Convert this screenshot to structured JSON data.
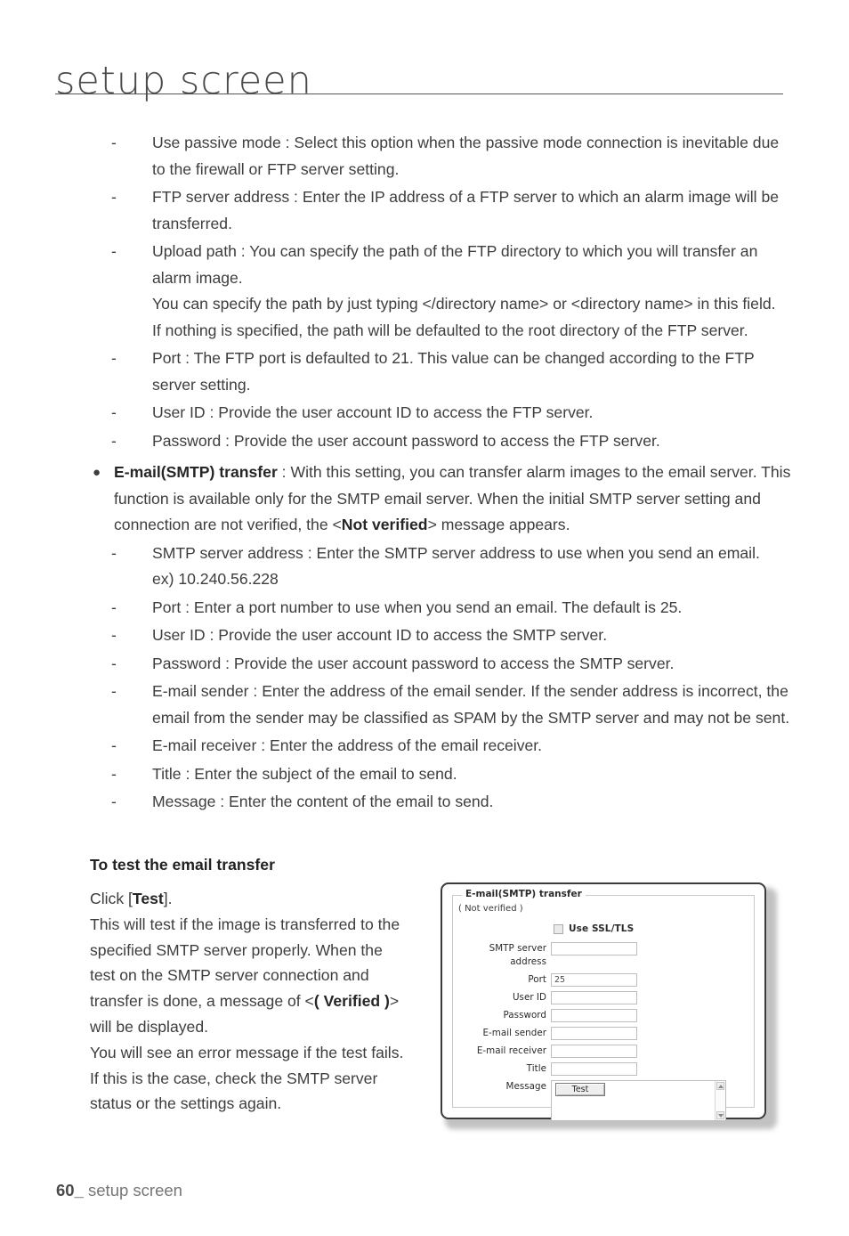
{
  "header": {
    "title": "setup screen"
  },
  "bullets": [
    {
      "mark": "-",
      "type": "dash",
      "lines": [
        "Use passive mode : Select this option when the passive mode connection is inevitable due to the firewall or FTP server setting."
      ]
    },
    {
      "mark": "-",
      "type": "dash",
      "lines": [
        "FTP server address : Enter the IP address of a FTP server to which an alarm image will be transferred."
      ]
    },
    {
      "mark": "-",
      "type": "dash",
      "lines": [
        "Upload path : You can specify the path of the FTP directory to which you will transfer an alarm image.",
        "You can specify the path by just typing </directory name> or <directory name> in this field.",
        "If nothing is specified, the path will be defaulted to the root directory of the FTP server."
      ]
    },
    {
      "mark": "-",
      "type": "dash",
      "lines": [
        "Port : The FTP port is defaulted to 21. This value can be changed according to the FTP server setting."
      ]
    },
    {
      "mark": "-",
      "type": "dash",
      "lines": [
        "User ID : Provide the user account ID to access the FTP server."
      ]
    },
    {
      "mark": "-",
      "type": "dash",
      "lines": [
        "Password : Provide the user account password to access the FTP server."
      ]
    }
  ],
  "smtp_bullet": {
    "mark": "●",
    "bold_lead": "E-mail(SMTP) transfer",
    "text_part1": " : With this setting, you can transfer alarm images to the email server. This function is available only for the SMTP email server. When the initial SMTP server setting and connection are not verified, the <",
    "bold_mid": "Not verified",
    "text_part2": "> message appears."
  },
  "smtp_bullets": [
    {
      "mark": "-",
      "lines": [
        "SMTP server address : Enter the SMTP server address to use when you send an email.",
        "ex) 10.240.56.228"
      ]
    },
    {
      "mark": "-",
      "lines": [
        "Port : Enter a port number to use when you send an email. The default is 25."
      ]
    },
    {
      "mark": "-",
      "lines": [
        "User ID : Provide the user account ID to access the SMTP server."
      ]
    },
    {
      "mark": "-",
      "lines": [
        "Password : Provide the user account password to access the SMTP server."
      ]
    },
    {
      "mark": "-",
      "lines": [
        "E-mail sender : Enter the address of the email sender. If the sender address is incorrect, the email from the sender may be classified as SPAM by the SMTP server and may not be sent."
      ]
    },
    {
      "mark": "-",
      "lines": [
        "E-mail receiver : Enter the address of the email receiver."
      ]
    },
    {
      "mark": "-",
      "lines": [
        "Title : Enter the subject of the email to send."
      ]
    },
    {
      "mark": "-",
      "lines": [
        "Message : Enter the content of the email to send."
      ]
    }
  ],
  "section": {
    "heading": "To test the email transfer",
    "line1_pre": "Click [",
    "line1_bold": "Test",
    "line1_post": "].",
    "line2": "This will test if the image is transferred to the specified SMTP server properly. When the test on the SMTP server connection and transfer is done, a message of <",
    "line2_bold": "( Verified )",
    "line2_post": "> will be displayed.",
    "line3": "You will see an error message if the test fails.",
    "line4": "If this is the case, check the SMTP server status or the settings again."
  },
  "dialog": {
    "legend": "E-mail(SMTP) transfer",
    "status": "( Not verified )",
    "ssl_label": "Use SSL/TLS",
    "ssl_checked": false,
    "fields": [
      {
        "label": "SMTP server address",
        "value": ""
      },
      {
        "label": "Port",
        "value": "25"
      },
      {
        "label": "User ID",
        "value": ""
      },
      {
        "label": "Password",
        "value": ""
      },
      {
        "label": "E-mail sender",
        "value": ""
      },
      {
        "label": "E-mail receiver",
        "value": ""
      },
      {
        "label": "Title",
        "value": ""
      }
    ],
    "message_label": "Message",
    "message_value": "",
    "test_button": "Test"
  },
  "footer": {
    "page_number": "60_",
    "label": "setup screen"
  }
}
